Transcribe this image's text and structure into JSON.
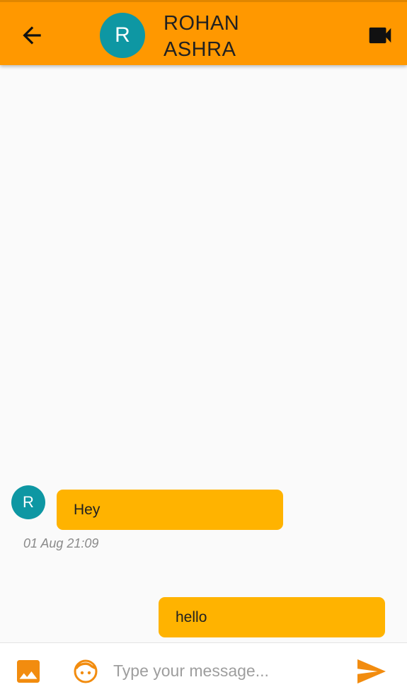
{
  "header": {
    "avatar_initial": "R",
    "name_line1": "ROHAN",
    "name_line2": "ASHRA",
    "back_icon": "arrow-back-icon",
    "video_icon": "videocam-icon"
  },
  "messages": [
    {
      "direction": "incoming",
      "avatar_initial": "R",
      "text": "Hey",
      "timestamp": "01 Aug 21:09"
    },
    {
      "direction": "outgoing",
      "text": "hello"
    }
  ],
  "composer": {
    "placeholder": "Type your message...",
    "value": "",
    "image_icon": "image-icon",
    "emoji_icon": "emoji-face-icon",
    "send_icon": "send-icon"
  },
  "colors": {
    "app_bar": "#ff9800",
    "bubble": "#ffb300",
    "avatar": "#0e97a3",
    "accent_icon": "#f28c0f",
    "background": "#fafafa"
  }
}
